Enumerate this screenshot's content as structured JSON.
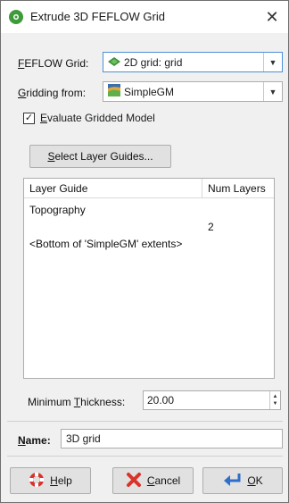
{
  "window": {
    "title": "Extrude 3D FEFLOW Grid",
    "close_glyph": "✕"
  },
  "feflow_grid": {
    "label_u": "F",
    "label_rest": "EFLOW Grid:",
    "value": "2D grid: grid",
    "icon": "grid-diamond-icon"
  },
  "gridding_from": {
    "label_u": "G",
    "label_rest": "ridding from:",
    "value": "SimpleGM",
    "icon": "geomodel-icon"
  },
  "evaluate": {
    "checked": true,
    "check_glyph": "✓",
    "label_u": "E",
    "label_rest": "valuate Gridded Model"
  },
  "select_layer_guides": {
    "label_pre": "",
    "label_u": "S",
    "label_rest": "elect Layer Guides..."
  },
  "table": {
    "headers": [
      "Layer Guide",
      "Num Layers"
    ],
    "rows": [
      {
        "guide": "Topography",
        "layers": ""
      },
      {
        "guide": "",
        "layers": "2"
      },
      {
        "guide": "<Bottom of 'SimpleGM' extents>",
        "layers": ""
      }
    ]
  },
  "min_thickness": {
    "label_pre": "Minimum ",
    "label_u": "T",
    "label_rest": "hickness:",
    "value": "20.00"
  },
  "name": {
    "label_u": "N",
    "label_rest": "ame:",
    "value": "3D grid"
  },
  "buttons": {
    "help_u": "H",
    "help_rest": "elp",
    "cancel_u": "C",
    "cancel_rest": "ancel",
    "ok_u": "O",
    "ok_rest": "K"
  },
  "colors": {
    "accent": "#3f9b3a",
    "help_icon": "#d9342b",
    "cancel_icon": "#d9342b",
    "ok_icon": "#2f6fc9"
  }
}
